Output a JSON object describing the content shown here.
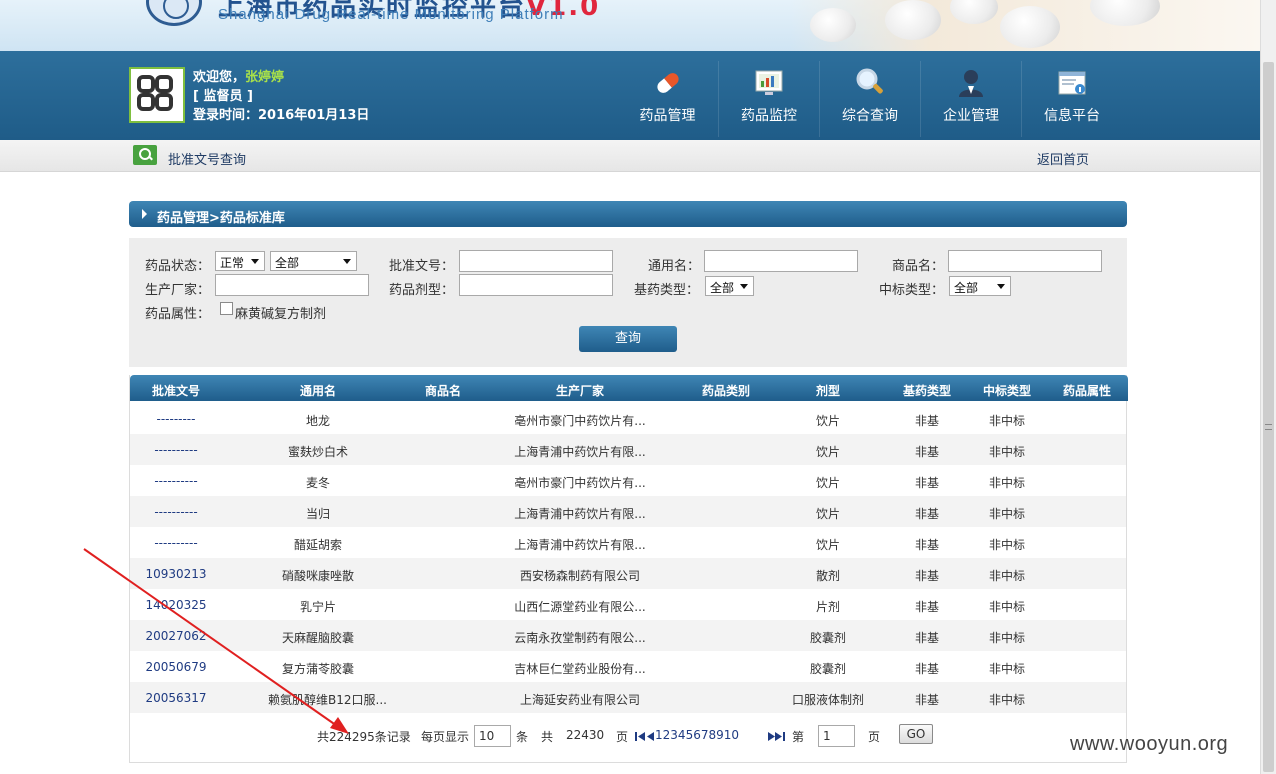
{
  "banner": {
    "cn_title": "上海市药品实时监控平台",
    "cn_suffix": "V1.0",
    "en_title": "Shanghai Drug Real-time Monitoring Platform"
  },
  "user": {
    "greeting": "欢迎您，",
    "name": "张婷婷",
    "role": "[ 监督员 ]",
    "login_label": "登录时间：",
    "login_date": "2016年01月13日"
  },
  "nav": [
    {
      "label": "药品管理",
      "icon": "capsule-icon"
    },
    {
      "label": "药品监控",
      "icon": "monitor-chart-icon"
    },
    {
      "label": "综合查询",
      "icon": "magnifier-icon"
    },
    {
      "label": "企业管理",
      "icon": "user-admin-icon"
    },
    {
      "label": "信息平台",
      "icon": "info-window-icon"
    }
  ],
  "toolbar": {
    "page_label": "批准文号查询",
    "home_link": "返回首页"
  },
  "breadcrumb": "药品管理>药品标准库",
  "filters": {
    "status_label": "药品状态：",
    "status_value": "正常",
    "status_sub_value": "全部",
    "approval_label": "批准文号：",
    "generic_label": "通用名：",
    "trade_label": "商品名：",
    "manufacturer_label": "生产厂家：",
    "dosage_label": "药品剂型：",
    "base_type_label": "基药类型：",
    "base_type_value": "全部",
    "bid_type_label": "中标类型：",
    "bid_type_value": "全部",
    "attr_label": "药品属性：",
    "attr_option": "麻黄碱复方制剂",
    "query_button": "查询"
  },
  "table": {
    "columns": [
      "批准文号",
      "通用名",
      "商品名",
      "生产厂家",
      "药品类别",
      "剂型",
      "基药类型",
      "中标类型",
      "药品属性"
    ],
    "rows": [
      [
        "---------",
        "地龙",
        "",
        "亳州市豪门中药饮片有...",
        "",
        "饮片",
        "非基",
        "非中标",
        ""
      ],
      [
        "----------",
        "蜜麸炒白术",
        "",
        "上海青浦中药饮片有限...",
        "",
        "饮片",
        "非基",
        "非中标",
        ""
      ],
      [
        "----------",
        "麦冬",
        "",
        "亳州市豪门中药饮片有...",
        "",
        "饮片",
        "非基",
        "非中标",
        ""
      ],
      [
        "----------",
        "当归",
        "",
        "上海青浦中药饮片有限...",
        "",
        "饮片",
        "非基",
        "非中标",
        ""
      ],
      [
        "----------",
        "醋延胡索",
        "",
        "上海青浦中药饮片有限...",
        "",
        "饮片",
        "非基",
        "非中标",
        ""
      ],
      [
        "10930213",
        "硝酸咪康唑散",
        "",
        "西安杨森制药有限公司",
        "",
        "散剂",
        "非基",
        "非中标",
        ""
      ],
      [
        "14020325",
        "乳宁片",
        "",
        "山西仁源堂药业有限公...",
        "",
        "片剂",
        "非基",
        "非中标",
        ""
      ],
      [
        "20027062",
        "天麻醒脑胶囊",
        "",
        "云南永孜堂制药有限公...",
        "",
        "胶囊剂",
        "非基",
        "非中标",
        ""
      ],
      [
        "20050679",
        "复方蒲苓胶囊",
        "",
        "吉林巨仁堂药业股份有...",
        "",
        "胶囊剂",
        "非基",
        "非中标",
        ""
      ],
      [
        "20056317",
        "赖氨肌醇维B12口服...",
        "",
        "上海延安药业有限公司",
        "",
        "口服液体制剂",
        "非基",
        "非中标",
        ""
      ]
    ]
  },
  "pager": {
    "total_text": "共224295条记录",
    "per_page_label": "每页显示",
    "per_page_value": "10",
    "per_page_unit": "条",
    "pages_prefix": "共",
    "total_pages": "22430",
    "pages_unit": "页",
    "page_numbers": [
      "1",
      "2",
      "3",
      "4",
      "5",
      "6",
      "7",
      "8",
      "9",
      "10"
    ],
    "goto_prefix": "第",
    "goto_value": "1",
    "goto_unit": "页",
    "go_button": "GO"
  },
  "watermark": "www.wooyun.org",
  "colors": {
    "header_blue": "#1f5c88",
    "accent_green": "#a8e04a",
    "annotation_red": "#e02020"
  }
}
